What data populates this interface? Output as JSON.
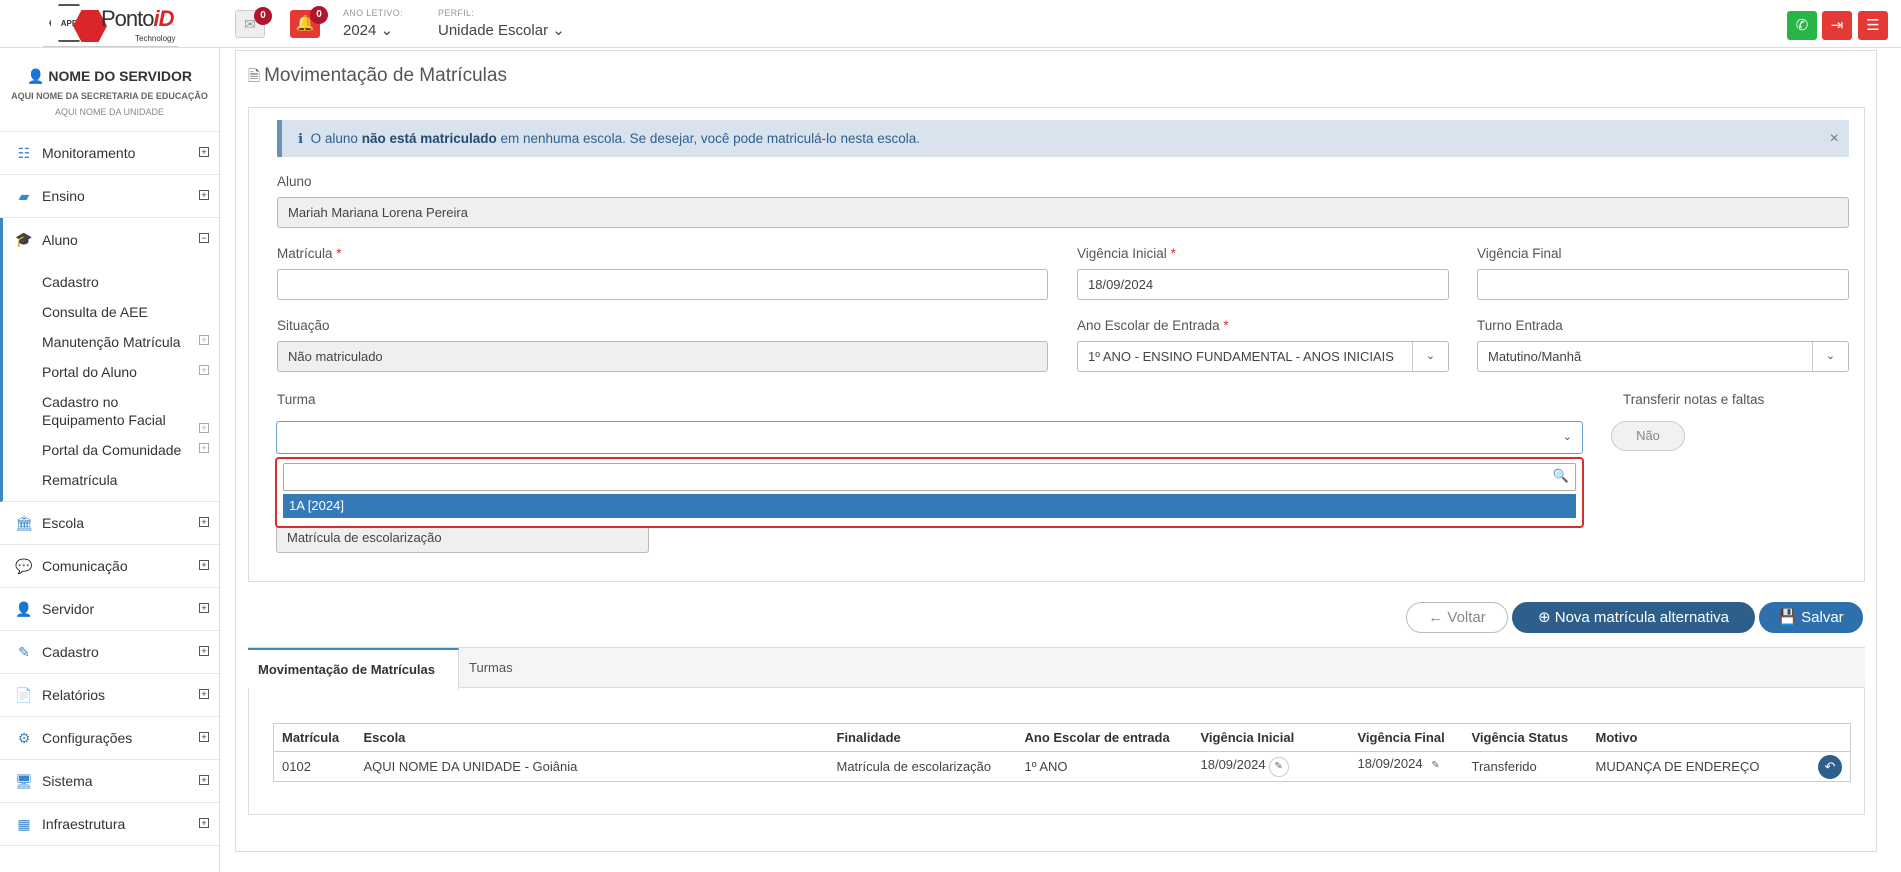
{
  "topbar": {
    "logo": {
      "brand_main": "Ponto",
      "brand_accent": "iD",
      "tagline": "Technology",
      "hex_text": "APE"
    },
    "envelope_count": "0",
    "bell_count": "0",
    "ano_letivo_label": "ANO LETIVO:",
    "ano_letivo_value": "2024 ⌄",
    "perfil_label": "PERFIL:",
    "perfil_value": "Unidade Escolar ⌄"
  },
  "sidebar": {
    "user_name": "NOME DO SERVIDOR",
    "secretaria": "AQUI NOME DA SECRETARIA DE EDUCAÇÃO",
    "unidade": "AQUI NOME DA UNIDADE",
    "items": [
      {
        "label": "Monitoramento",
        "icon": "sliders-icon"
      },
      {
        "label": "Ensino",
        "icon": "book-icon"
      },
      {
        "label": "Aluno",
        "icon": "graduation-cap-icon"
      },
      {
        "label": "Escola",
        "icon": "bank-icon"
      },
      {
        "label": "Comunicação",
        "icon": "chat-icon"
      },
      {
        "label": "Servidor",
        "icon": "user-icon"
      },
      {
        "label": "Cadastro",
        "icon": "edit-icon"
      },
      {
        "label": "Relatórios",
        "icon": "file-icon"
      },
      {
        "label": "Configurações",
        "icon": "gear-icon"
      },
      {
        "label": "Sistema",
        "icon": "monitor-icon"
      },
      {
        "label": "Infraestrutura",
        "icon": "building-icon"
      }
    ],
    "aluno_submenu": [
      {
        "label": "Cadastro"
      },
      {
        "label": "Consulta de AEE"
      },
      {
        "label": "Manutenção Matrícula"
      },
      {
        "label": "Portal do Aluno"
      },
      {
        "label": "Cadastro no Equipamento Facial"
      },
      {
        "label": "Portal da Comunidade"
      },
      {
        "label": "Rematrícula"
      }
    ]
  },
  "page": {
    "title": "Movimentação de Matrículas",
    "alert": {
      "prefix": "O aluno ",
      "bold": "não está matriculado",
      "suffix": " em nenhuma escola. Se desejar, você pode matriculá-lo nesta escola."
    },
    "form": {
      "aluno_label": "Aluno",
      "aluno_value": "Mariah Mariana Lorena Pereira",
      "matricula_label": "Matrícula",
      "matricula_value": "",
      "vig_ini_label": "Vigência Inicial",
      "vig_ini_value": "18/09/2024",
      "vig_fin_label": "Vigência Final",
      "vig_fin_value": "",
      "situacao_label": "Situação",
      "situacao_value": "Não matriculado",
      "ano_escolar_label": "Ano Escolar de Entrada",
      "ano_escolar_value": "1º ANO - ENSINO FUNDAMENTAL - ANOS INICIAIS",
      "turno_label": "Turno Entrada",
      "turno_value": "Matutino/Manhã",
      "turma_label": "Turma",
      "turma_value": "",
      "transferir_label": "Transferir notas e faltas",
      "transferir_value": "Não",
      "dropdown_search": "",
      "dropdown_option": "1A [2024]",
      "finalidade_value": "Matrícula de escolarização",
      "required_mark": "*"
    },
    "buttons": {
      "voltar": "Voltar",
      "nova": "Nova matrícula alternativa",
      "salvar": "Salvar"
    },
    "tabs": [
      "Movimentação de Matrículas",
      "Turmas"
    ],
    "table": {
      "headers": [
        "Matrícula",
        "Escola",
        "Finalidade",
        "Ano Escolar de entrada",
        "Vigência Inicial",
        "Vigência Final",
        "Vigência Status",
        "Motivo"
      ],
      "rows": [
        [
          "0102",
          "AQUI NOME DA UNIDADE - Goiânia",
          "Matrícula de escolarização",
          "1º ANO",
          "18/09/2024",
          "18/09/2024",
          "Transferido",
          "MUDANÇA DE ENDEREÇO"
        ]
      ]
    }
  },
  "colors": {
    "accent": "#3a87c8",
    "danger": "#e53935",
    "whatsapp": "#28b446",
    "primary_dark": "#2e5f8a",
    "alert_bg": "#d9e3ee"
  }
}
